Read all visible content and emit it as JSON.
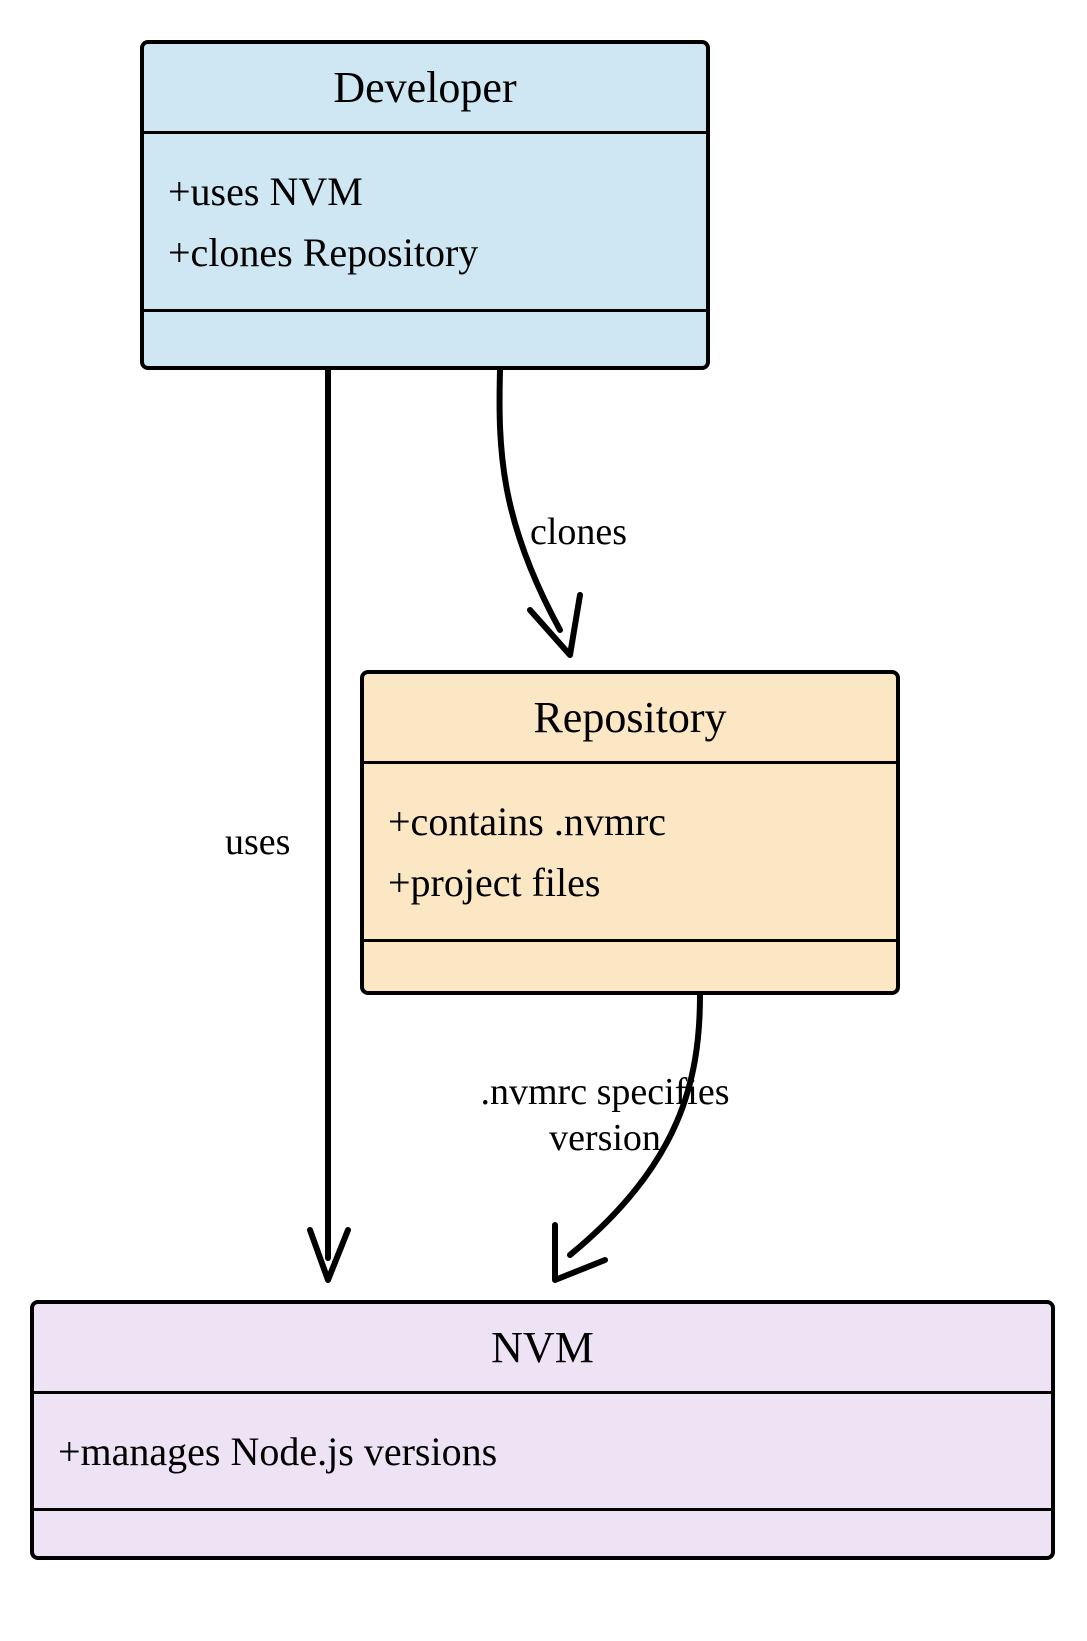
{
  "classes": {
    "developer": {
      "title": "Developer",
      "attrs": [
        "+uses NVM",
        "+clones Repository"
      ],
      "color": "#cfe7f2"
    },
    "repository": {
      "title": "Repository",
      "attrs": [
        "+contains .nvmrc",
        "+project files"
      ],
      "color": "#fce7c5"
    },
    "nvm": {
      "title": "NVM",
      "attrs": [
        "+manages Node.js versions"
      ],
      "color": "#ede3f4"
    }
  },
  "edges": {
    "uses": {
      "label": "uses"
    },
    "clones": {
      "label": "clones"
    },
    "specifies": {
      "label_line1": ".nvmrc specifies",
      "label_line2": "version"
    }
  }
}
